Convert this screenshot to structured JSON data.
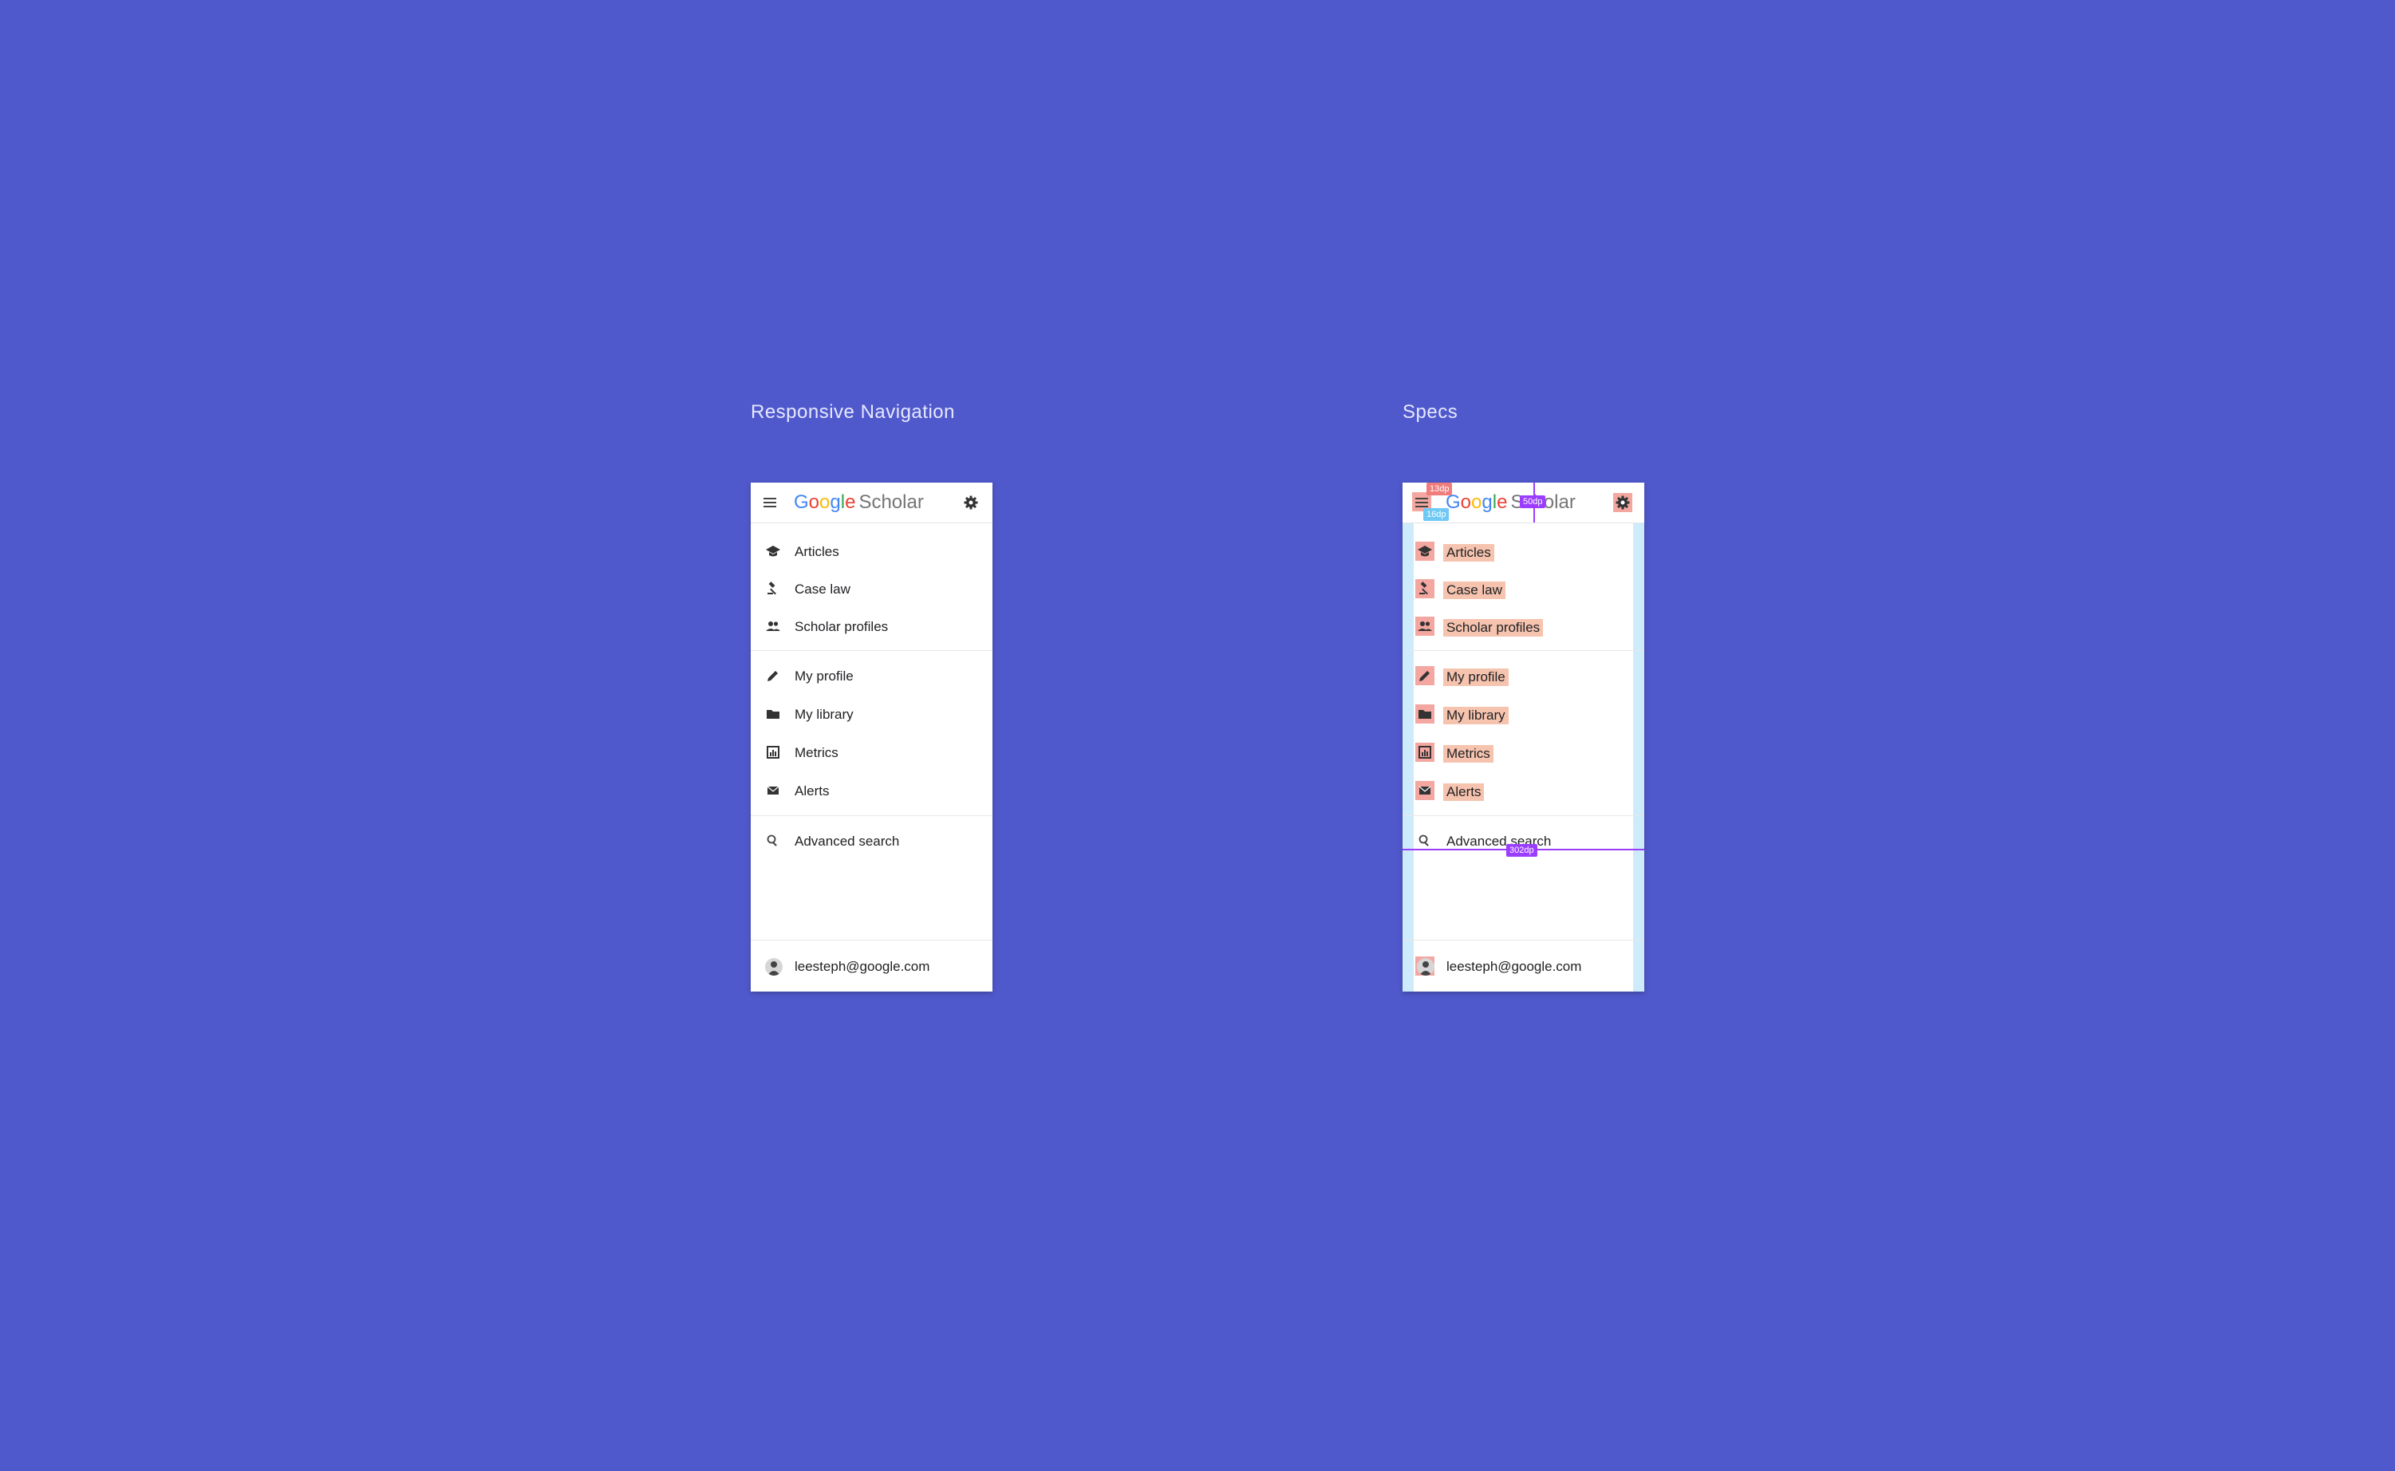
{
  "frames": {
    "left_title": "Responsive Navigation",
    "right_title": "Specs"
  },
  "header": {
    "logo_google": [
      "G",
      "o",
      "o",
      "g",
      "l",
      "e"
    ],
    "logo_scholar": "Scholar",
    "menu_icon": "menu-icon",
    "settings_icon": "gear-icon"
  },
  "nav": {
    "group1": [
      {
        "label": "Articles",
        "icon": "mortarboard-icon"
      },
      {
        "label": "Case law",
        "icon": "gavel-icon"
      },
      {
        "label": "Scholar profiles",
        "icon": "people-icon"
      }
    ],
    "group2": [
      {
        "label": "My profile",
        "icon": "pencil-icon"
      },
      {
        "label": "My library",
        "icon": "folder-icon"
      },
      {
        "label": "Metrics",
        "icon": "chart-icon"
      },
      {
        "label": "Alerts",
        "icon": "envelope-icon"
      }
    ],
    "group3": [
      {
        "label": "Advanced search",
        "icon": "search-icon"
      }
    ]
  },
  "account": {
    "email": "leesteph@google.com"
  },
  "specs": {
    "tag_13": "13dp",
    "tag_16": "16dp",
    "tag_50": "50dp",
    "tag_302": "302dp"
  },
  "colors": {
    "background": "#5059CC",
    "spec_highlight": "#F6C3AE",
    "spec_margin": "#CDEBFA",
    "spec_purple": "#9B3DFF"
  }
}
